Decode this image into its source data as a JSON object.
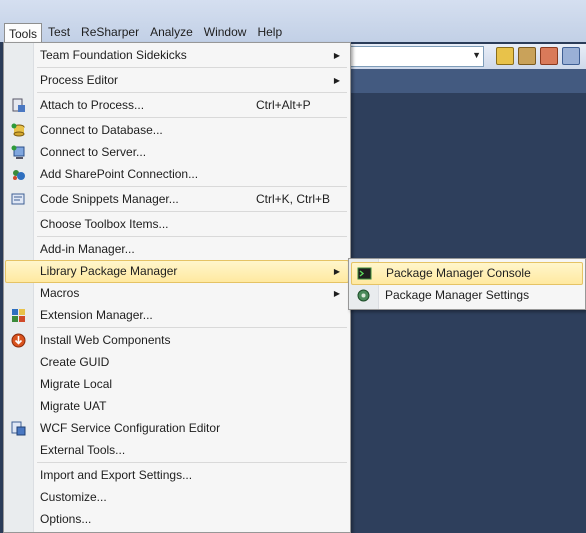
{
  "menubar": {
    "items": [
      {
        "label": "Tools",
        "open": true
      },
      {
        "label": "Test"
      },
      {
        "label": "ReSharper"
      },
      {
        "label": "Analyze"
      },
      {
        "label": "Window"
      },
      {
        "label": "Help"
      }
    ]
  },
  "tools_menu": {
    "items": [
      {
        "label": "Team Foundation Sidekicks",
        "submenu": true
      },
      {
        "label": "Process Editor",
        "submenu": true
      },
      {
        "label": "Attach to Process...",
        "shortcut": "Ctrl+Alt+P",
        "icon": "attach-process-icon"
      },
      {
        "label": "Connect to Database...",
        "icon": "database-connect-icon"
      },
      {
        "label": "Connect to Server...",
        "icon": "server-connect-icon"
      },
      {
        "label": "Add SharePoint Connection...",
        "icon": "sharepoint-icon"
      },
      {
        "label": "Code Snippets Manager...",
        "shortcut": "Ctrl+K, Ctrl+B",
        "icon": "snippets-icon"
      },
      {
        "label": "Choose Toolbox Items..."
      },
      {
        "label": "Add-in Manager..."
      },
      {
        "label": "Library Package Manager",
        "submenu": true,
        "highlighted": true
      },
      {
        "label": "Macros",
        "submenu": true
      },
      {
        "label": "Extension Manager...",
        "icon": "extension-icon"
      },
      {
        "label": "Install Web Components",
        "icon": "install-web-icon"
      },
      {
        "label": "Create GUID"
      },
      {
        "label": "Migrate Local"
      },
      {
        "label": "Migrate UAT"
      },
      {
        "label": "WCF Service Configuration Editor",
        "icon": "wcf-config-icon"
      },
      {
        "label": "External Tools..."
      },
      {
        "label": "Import and Export Settings..."
      },
      {
        "label": "Customize..."
      },
      {
        "label": "Options..."
      }
    ]
  },
  "package_submenu": {
    "items": [
      {
        "label": "Package Manager Console",
        "icon": "console-icon",
        "highlighted": true
      },
      {
        "label": "Package Manager Settings",
        "icon": "settings-icon"
      }
    ]
  },
  "colors": {
    "highlight": "#ffe9a0",
    "menubar": "#c2d0e6",
    "workspace": "#2e3f5c"
  }
}
